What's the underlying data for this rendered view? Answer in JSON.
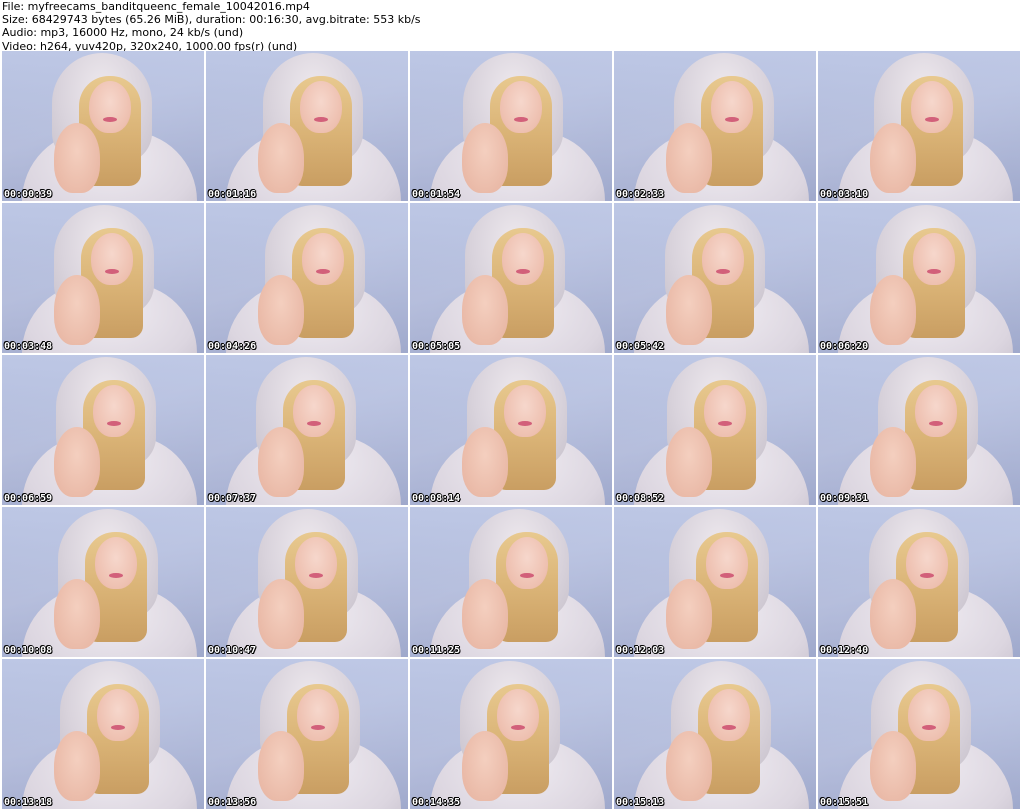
{
  "header": {
    "file_line": "File: myfreecams_banditqueenc_female_10042016.mp4",
    "size_line": "Size: 68429743 bytes (65.26 MiB), duration: 00:16:30, avg.bitrate: 553 kb/s",
    "audio_line": "Audio: mp3, 16000 Hz, mono, 24 kb/s (und)",
    "video_line": "Video: h264, yuv420p, 320x240, 1000.00 fps(r) (und)"
  },
  "thumbnails": [
    "00:00:39",
    "00:01:16",
    "00:01:54",
    "00:02:33",
    "00:03:10",
    "00:03:48",
    "00:04:26",
    "00:05:05",
    "00:05:42",
    "00:06:20",
    "00:06:59",
    "00:07:37",
    "00:08:14",
    "00:08:52",
    "00:09:31",
    "00:10:08",
    "00:10:47",
    "00:11:25",
    "00:12:03",
    "00:12:40",
    "00:13:18",
    "00:13:56",
    "00:14:35",
    "00:15:13",
    "00:15:51"
  ]
}
